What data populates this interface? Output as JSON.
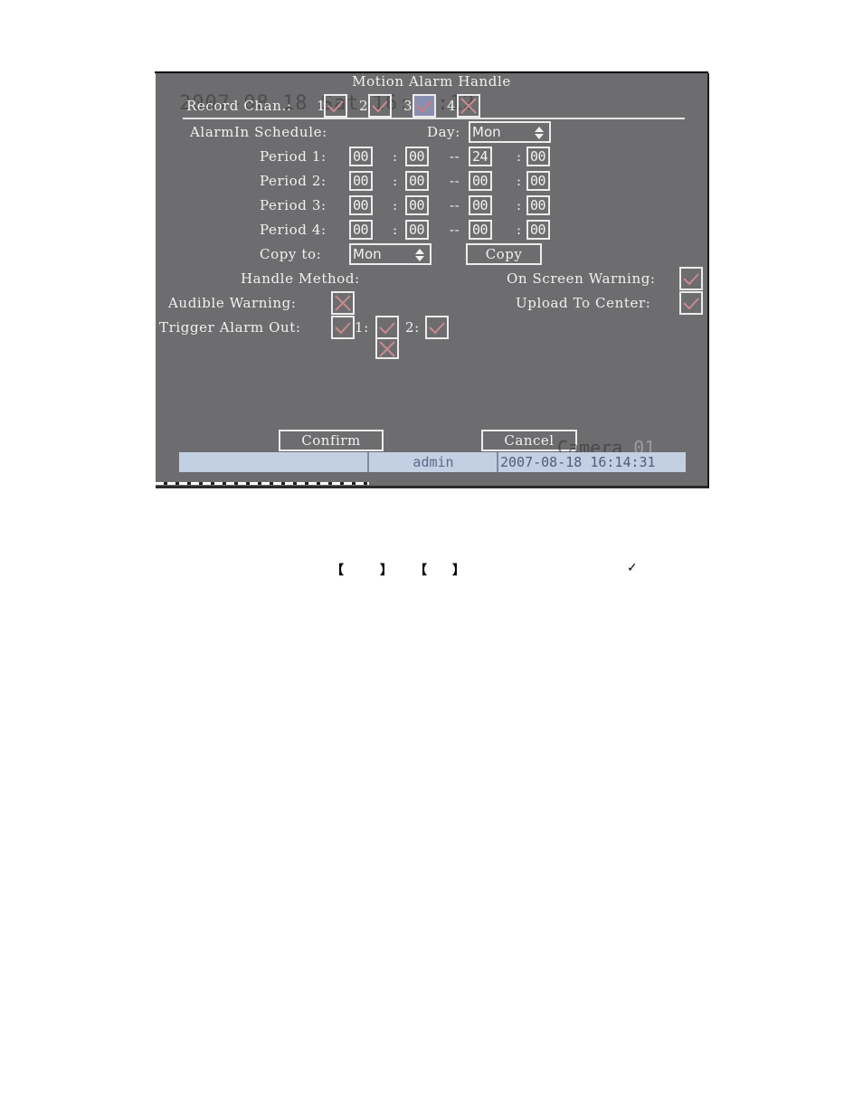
{
  "screen": {
    "title": "Motion Alarm Handle",
    "ghost_osd": "2007-08-18 Sat 16:14:12",
    "record_chan": {
      "label": "Record Chan.:",
      "channels": [
        {
          "num": "1",
          "state": "checked",
          "highlighted": false
        },
        {
          "num": "2",
          "state": "checked",
          "highlighted": false
        },
        {
          "num": "3",
          "state": "checked",
          "highlighted": true
        },
        {
          "num": "4",
          "state": "unchecked",
          "highlighted": false
        }
      ]
    },
    "schedule": {
      "label": "AlarmIn Schedule:",
      "day_label": "Day:",
      "day_value": "Mon",
      "periods": [
        {
          "label": "Period 1:",
          "start_h": "00",
          "start_m": "00",
          "end_h": "24",
          "end_m": "00"
        },
        {
          "label": "Period 2:",
          "start_h": "00",
          "start_m": "00",
          "end_h": "00",
          "end_m": "00"
        },
        {
          "label": "Period 3:",
          "start_h": "00",
          "start_m": "00",
          "end_h": "00",
          "end_m": "00"
        },
        {
          "label": "Period 4:",
          "start_h": "00",
          "start_m": "00",
          "end_h": "00",
          "end_m": "00"
        }
      ],
      "colon": ":",
      "dash": "--",
      "copy_to_label": "Copy to:",
      "copy_to_value": "Mon",
      "copy_button": "Copy"
    },
    "handle": {
      "label": "Handle Method:",
      "on_screen_warning": {
        "label": "On Screen Warning:",
        "state": "checked"
      },
      "audible_warning": {
        "label": "Audible Warning:",
        "state": "unchecked"
      },
      "upload_to_center": {
        "label": "Upload To Center:",
        "state": "checked"
      },
      "trigger_alarm_out": {
        "label": "Trigger Alarm Out:",
        "state": "checked",
        "outputs": [
          {
            "num": "1:",
            "state": "checked",
            "dropdown_state": "unchecked"
          },
          {
            "num": "2:",
            "state": "checked"
          }
        ]
      }
    },
    "buttons": {
      "confirm": "Confirm",
      "cancel": "Cancel"
    },
    "camera_osd": {
      "name": "Camera",
      "num": "01"
    },
    "status_bar": {
      "left": "",
      "user": "admin",
      "datetime": "2007-08-18 16:14:31"
    },
    "colors": {
      "background": "#6d6d6f",
      "check_mark": "#c98a8e",
      "status_bar": "#c3d0e3"
    }
  },
  "document": {
    "bracket_open_1": "【",
    "bracket_close_1": "】",
    "bracket_open_2": "【",
    "bracket_close_2": "】",
    "checkmark": "✓"
  }
}
